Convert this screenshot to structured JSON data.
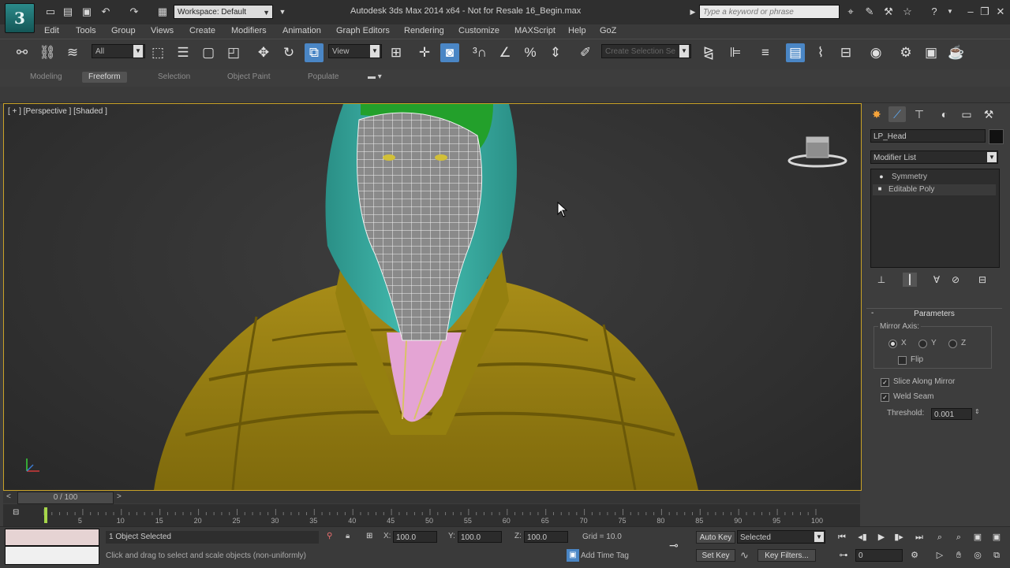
{
  "app": {
    "logo_text": "3",
    "window_title": "Autodesk 3ds Max  2014 x64   - Not for Resale   16_Begin.max",
    "workspace": "Workspace: Default",
    "search_placeholder": "Type a keyword or phrase"
  },
  "menu": [
    "Edit",
    "Tools",
    "Group",
    "Views",
    "Create",
    "Modifiers",
    "Animation",
    "Graph Editors",
    "Rendering",
    "Customize",
    "MAXScript",
    "Help",
    "GoZ"
  ],
  "toolbar": {
    "selection_filter": "All",
    "ref_coord": "View",
    "named_selection": "Create Selection Se"
  },
  "ribbon": {
    "tabs": [
      "Modeling",
      "Freeform",
      "Selection",
      "Object Paint",
      "Populate"
    ],
    "active_tab": "Freeform"
  },
  "viewport": {
    "label": "[ + ] [Perspective ] [Shaded ]"
  },
  "command_panel": {
    "object_name": "LP_Head",
    "modifier_list": "Modifier List",
    "stack": [
      "Symmetry",
      "Editable Poly"
    ],
    "rollout_title": "Parameters",
    "mirror_axis_label": "Mirror Axis:",
    "axes": [
      "X",
      "Y",
      "Z"
    ],
    "selected_axis": "X",
    "flip_label": "Flip",
    "flip_checked": false,
    "slice_label": "Slice Along Mirror",
    "slice_checked": true,
    "weld_label": "Weld Seam",
    "weld_checked": true,
    "threshold_label": "Threshold:",
    "threshold_value": "0.001"
  },
  "timeline": {
    "frame_display": "0 / 100",
    "ticks": [
      "5",
      "10",
      "15",
      "20",
      "25",
      "30",
      "35",
      "40",
      "45",
      "50",
      "55",
      "60",
      "65",
      "70",
      "75",
      "80",
      "85",
      "90",
      "95",
      "100"
    ]
  },
  "status": {
    "selection": "1 Object Selected",
    "prompt": "Click and drag to select and scale objects (non-uniformly)",
    "x_label": "X:",
    "x_value": "100.0",
    "y_label": "Y:",
    "y_value": "100.0",
    "z_label": "Z:",
    "z_value": "100.0",
    "grid": "Grid = 10.0",
    "auto_key": "Auto Key",
    "set_key": "Set Key",
    "key_mode": "Selected",
    "key_filters": "Key Filters...",
    "add_time_tag": "Add Time Tag",
    "current_frame": "0"
  },
  "colors": {
    "viewport_border": "#c9a227",
    "jacket": "#9a8214",
    "hood": "#3bb3a8",
    "cap": "#23a02b",
    "shirt": "#e4a4d4",
    "active_tool": "#4a86c5"
  }
}
